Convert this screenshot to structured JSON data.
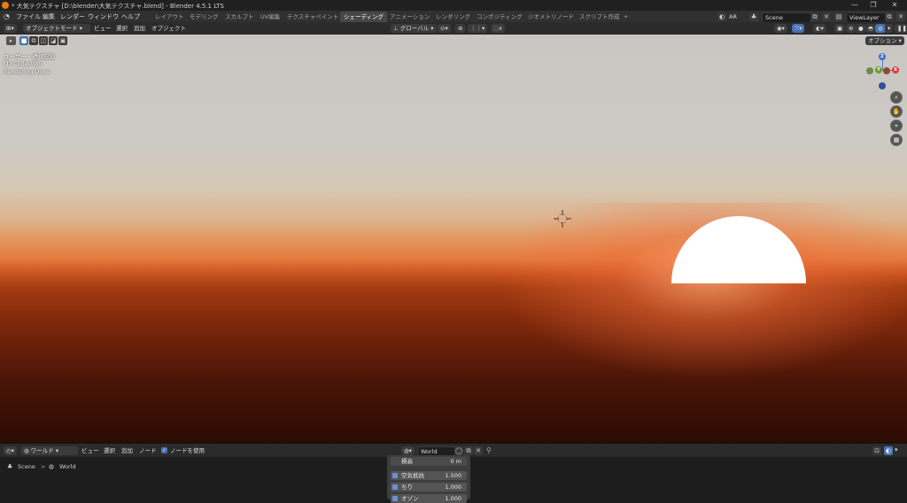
{
  "titlebar": {
    "title": "* 大気テクスチャ [D:\\blender\\大気テクスチャ.blend] - Blender 4.5.1 LTS",
    "min": "—",
    "max": "❐",
    "close": "✕"
  },
  "menu": [
    "ファイル",
    "編集",
    "レンダー",
    "ウィンドウ",
    "ヘルプ"
  ],
  "workspaces": [
    "レイアウト",
    "モデリング",
    "スカルプト",
    "UV編集",
    "テクスチャペイント",
    "シェーディング",
    "アニメーション",
    "レンダリング",
    "コンポジティング",
    "ジオメトリノード",
    "スクリプト作成"
  ],
  "workspace_add": "+",
  "active_workspace": "シェーディング",
  "top_right": {
    "ar_label": "AR",
    "scene": "Scene",
    "view_layer": "ViewLayer"
  },
  "viewport_header": {
    "mode": "オブジェクトモード",
    "menus": [
      "ビュー",
      "選択",
      "追加",
      "オブジェクト"
    ],
    "orientation": "グローバル",
    "options": "オプション"
  },
  "viewport_overlay": {
    "view_name": "ユーザー・透視投影",
    "collection": "(1) Collection",
    "status": "Rendering Done"
  },
  "gizmo": {
    "x": "X",
    "y": "Y",
    "z": "Z"
  },
  "node_editor": {
    "editor_type": "ワールド",
    "menus": [
      "ビュー",
      "選択",
      "追加",
      "ノード"
    ],
    "use_nodes_label": "ノードを使用",
    "use_nodes_checked": true,
    "world_name": "World",
    "breadcrumb": {
      "scene": "Scene",
      "world": "World",
      "sep": ">"
    }
  },
  "sky_panel": {
    "altitude": {
      "label": "標高",
      "value": "0 m"
    },
    "rows": [
      {
        "label": "空気抵抗",
        "value": "1.500"
      },
      {
        "label": "ちり",
        "value": "1.000"
      },
      {
        "label": "オゾン",
        "value": "1.000"
      }
    ]
  },
  "colors": {
    "accent": "#4772b3",
    "active_tab": "#474747",
    "sun": "#ffffff"
  }
}
